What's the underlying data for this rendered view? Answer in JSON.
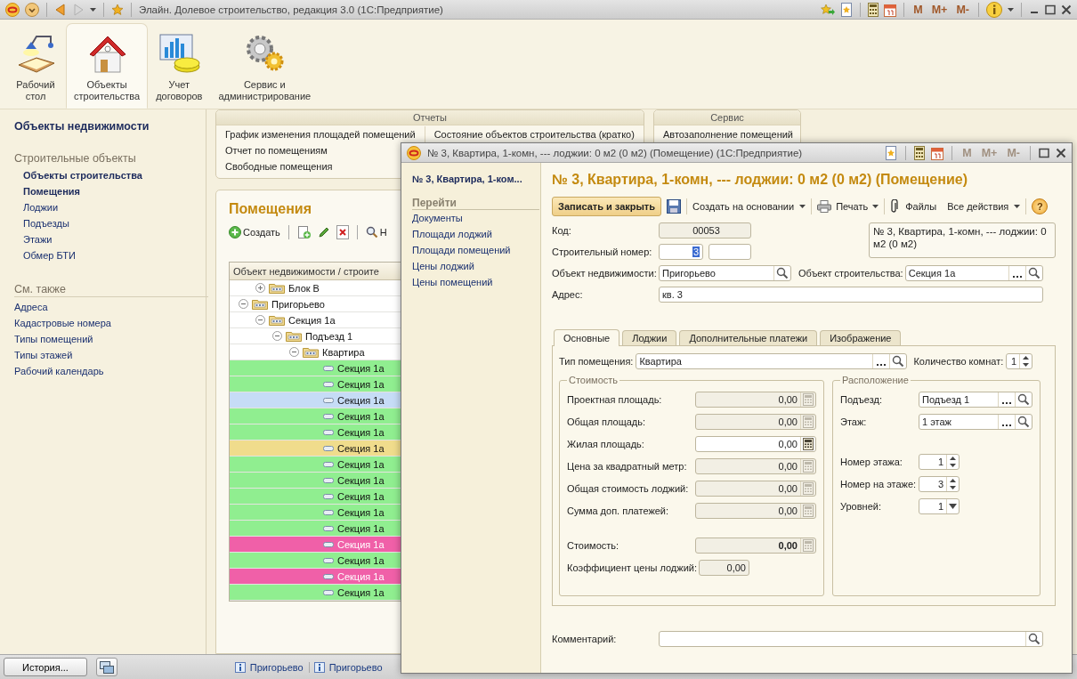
{
  "app": {
    "title": "Элайн. Долевое строительство, редакция 3.0  (1С:Предприятие)",
    "memory_buttons": [
      {
        "label": "M",
        "disabled": false
      },
      {
        "label": "M+",
        "disabled": false
      },
      {
        "label": "M-",
        "disabled": false
      }
    ]
  },
  "sections": [
    {
      "label": "Рабочий\nстол",
      "selected": false
    },
    {
      "label": "Объекты\nстроительства",
      "selected": true
    },
    {
      "label": "Учет\nдоговоров",
      "selected": false
    },
    {
      "label": "Сервис и\nадминистрирование",
      "selected": false
    }
  ],
  "nav": {
    "top": "Объекты недвижимости",
    "groups": [
      {
        "title": "Строительные объекты",
        "items": [
          {
            "label": "Объекты строительства",
            "important": true
          },
          {
            "label": "Помещения",
            "important": true
          },
          {
            "label": "Лоджии",
            "important": false
          },
          {
            "label": "Подъезды",
            "important": false
          },
          {
            "label": "Этажи",
            "important": false
          },
          {
            "label": "Обмер БТИ",
            "important": false
          }
        ]
      },
      {
        "title": "См. также",
        "items": [
          {
            "label": "Адреса",
            "important": false
          },
          {
            "label": "Кадастровые номера",
            "important": false
          },
          {
            "label": "Типы помещений",
            "important": false
          },
          {
            "label": "Типы этажей",
            "important": false
          },
          {
            "label": "Рабочий календарь",
            "important": false
          }
        ]
      }
    ]
  },
  "reports": {
    "title": "Отчеты",
    "columns": [
      [
        "График изменения площадей помещений",
        "Отчет по помещениям",
        "Свободные помещения"
      ],
      [
        "Состояние объектов строительства (кратко)"
      ]
    ]
  },
  "service": {
    "title": "Сервис",
    "items": [
      "Автозаполнение помещений"
    ]
  },
  "list": {
    "title": "Помещения",
    "create": "Создать",
    "find": "Н",
    "column": "Объект недвижимости / строите",
    "tree": [
      {
        "children": [
          {
            "label": "Блок В",
            "expanded": false
          }
        ]
      },
      {
        "label": "Пригорьево",
        "expanded": true,
        "children": [
          {
            "label": "Секция 1а",
            "expanded": true,
            "children": [
              {
                "label": "Подъезд 1",
                "expanded": true,
                "children": [
                  {
                    "label": "Квартира",
                    "expanded": true,
                    "children": [
                      {
                        "label": "Секция 1а",
                        "color": "#90ee90"
                      },
                      {
                        "label": "Секция 1а",
                        "color": "#90ee90"
                      },
                      {
                        "label": "Секция 1а",
                        "color": "#c6dcf6"
                      },
                      {
                        "label": "Секция 1а",
                        "color": "#90ee90"
                      },
                      {
                        "label": "Секция 1а",
                        "color": "#90ee90"
                      },
                      {
                        "label": "Секция 1а",
                        "color": "#f0dc8c"
                      },
                      {
                        "label": "Секция 1а",
                        "color": "#90ee90"
                      },
                      {
                        "label": "Секция 1а",
                        "color": "#90ee90"
                      },
                      {
                        "label": "Секция 1а",
                        "color": "#90ee90"
                      },
                      {
                        "label": "Секция 1а",
                        "color": "#90ee90"
                      },
                      {
                        "label": "Секция 1а",
                        "color": "#90ee90"
                      },
                      {
                        "label": "Секция 1а",
                        "color": "#f060a8"
                      },
                      {
                        "label": "Секция 1а",
                        "color": "#90ee90"
                      },
                      {
                        "label": "Секция 1а",
                        "color": "#f060a8"
                      },
                      {
                        "label": "Секция 1а",
                        "color": "#90ee90"
                      }
                    ]
                  }
                ]
              }
            ]
          }
        ]
      }
    ]
  },
  "status_bar": {
    "history": "История...",
    "links": [
      "Пригорьево",
      "Пригорьево"
    ]
  },
  "dialog": {
    "title": "№ 3, Квартира, 1-комн, --- лоджии: 0 м2  (0 м2) (Помещение)  (1С:Предприятие)",
    "memory_buttons": [
      {
        "label": "M",
        "disabled": true
      },
      {
        "label": "M+",
        "disabled": true
      },
      {
        "label": "M-",
        "disabled": true
      }
    ],
    "current": "№ 3, Квартира, 1-ком...",
    "goto_title": "Перейти",
    "goto_links": [
      "Документы",
      "Площади лоджий",
      "Площади помещений",
      "Цены лоджий",
      "Цены помещений"
    ],
    "heading": "№ 3, Квартира, 1-комн, --- лоджии: 0 м2  (0 м2) (Помещение)",
    "toolbar": {
      "save_close": "Записать и закрыть",
      "create_based": "Создать на основании",
      "print": "Печать",
      "files": "Файлы",
      "all_actions": "Все действия",
      "help": "?"
    },
    "code": {
      "label": "Код:",
      "value": "00053"
    },
    "build_number": {
      "label": "Строительный номер:",
      "value": "3"
    },
    "description": "№ 3, Квартира, 1-комн, --- лоджии: 0 м2  (0 м2)",
    "realty": {
      "label": "Объект недвижимости:",
      "value": "Пригорьево"
    },
    "construction": {
      "label": "Объект строительства:",
      "value": "Секция 1а"
    },
    "address": {
      "label": "Адрес:",
      "value": "кв. 3"
    },
    "tabs": [
      {
        "label": "Основные",
        "selected": true
      },
      {
        "label": "Лоджии",
        "selected": false
      },
      {
        "label": "Дополнительные платежи",
        "selected": false
      },
      {
        "label": "Изображение",
        "selected": false
      }
    ],
    "room_type": {
      "label": "Тип помещения:",
      "value": "Квартира"
    },
    "rooms": {
      "label": "Количество комнат:",
      "value": "1"
    },
    "cost": {
      "title": "Стоимость",
      "rows": [
        {
          "kind": "calc",
          "label": "Проектная площадь:",
          "value": "0,00",
          "readonly": true
        },
        {
          "kind": "calc",
          "label": "Общая площадь:",
          "value": "0,00",
          "readonly": true
        },
        {
          "kind": "calc",
          "label": "Жилая площадь:",
          "value": "0,00",
          "readonly": false
        },
        {
          "kind": "calc",
          "label": "Цена за квадратный метр:",
          "value": "0,00",
          "readonly": true
        },
        {
          "kind": "calc",
          "label": "Общая стоимость лоджий:",
          "value": "0,00",
          "readonly": true
        },
        {
          "kind": "calc",
          "label": "Сумма доп. платежей:",
          "value": "0,00",
          "readonly": true
        },
        {
          "kind": "total",
          "label": "Стоимость:",
          "value": "0,00",
          "readonly": true
        },
        {
          "kind": "number",
          "label": "Коэффициент цены лоджий:",
          "value": "0,00",
          "readonly": true
        }
      ]
    },
    "location": {
      "title": "Расположение",
      "rows": [
        {
          "kind": "ref",
          "label": "Подъезд:",
          "value": "Подъезд 1"
        },
        {
          "kind": "ref",
          "label": "Этаж:",
          "value": "1 этаж"
        },
        {
          "kind": "spin",
          "label": "Номер этажа:",
          "value": "1"
        },
        {
          "kind": "spin",
          "label": "Номер на этаже:",
          "value": "3"
        },
        {
          "kind": "select",
          "label": "Уровней:",
          "value": "1"
        }
      ]
    },
    "comment": {
      "label": "Комментарий:"
    }
  }
}
